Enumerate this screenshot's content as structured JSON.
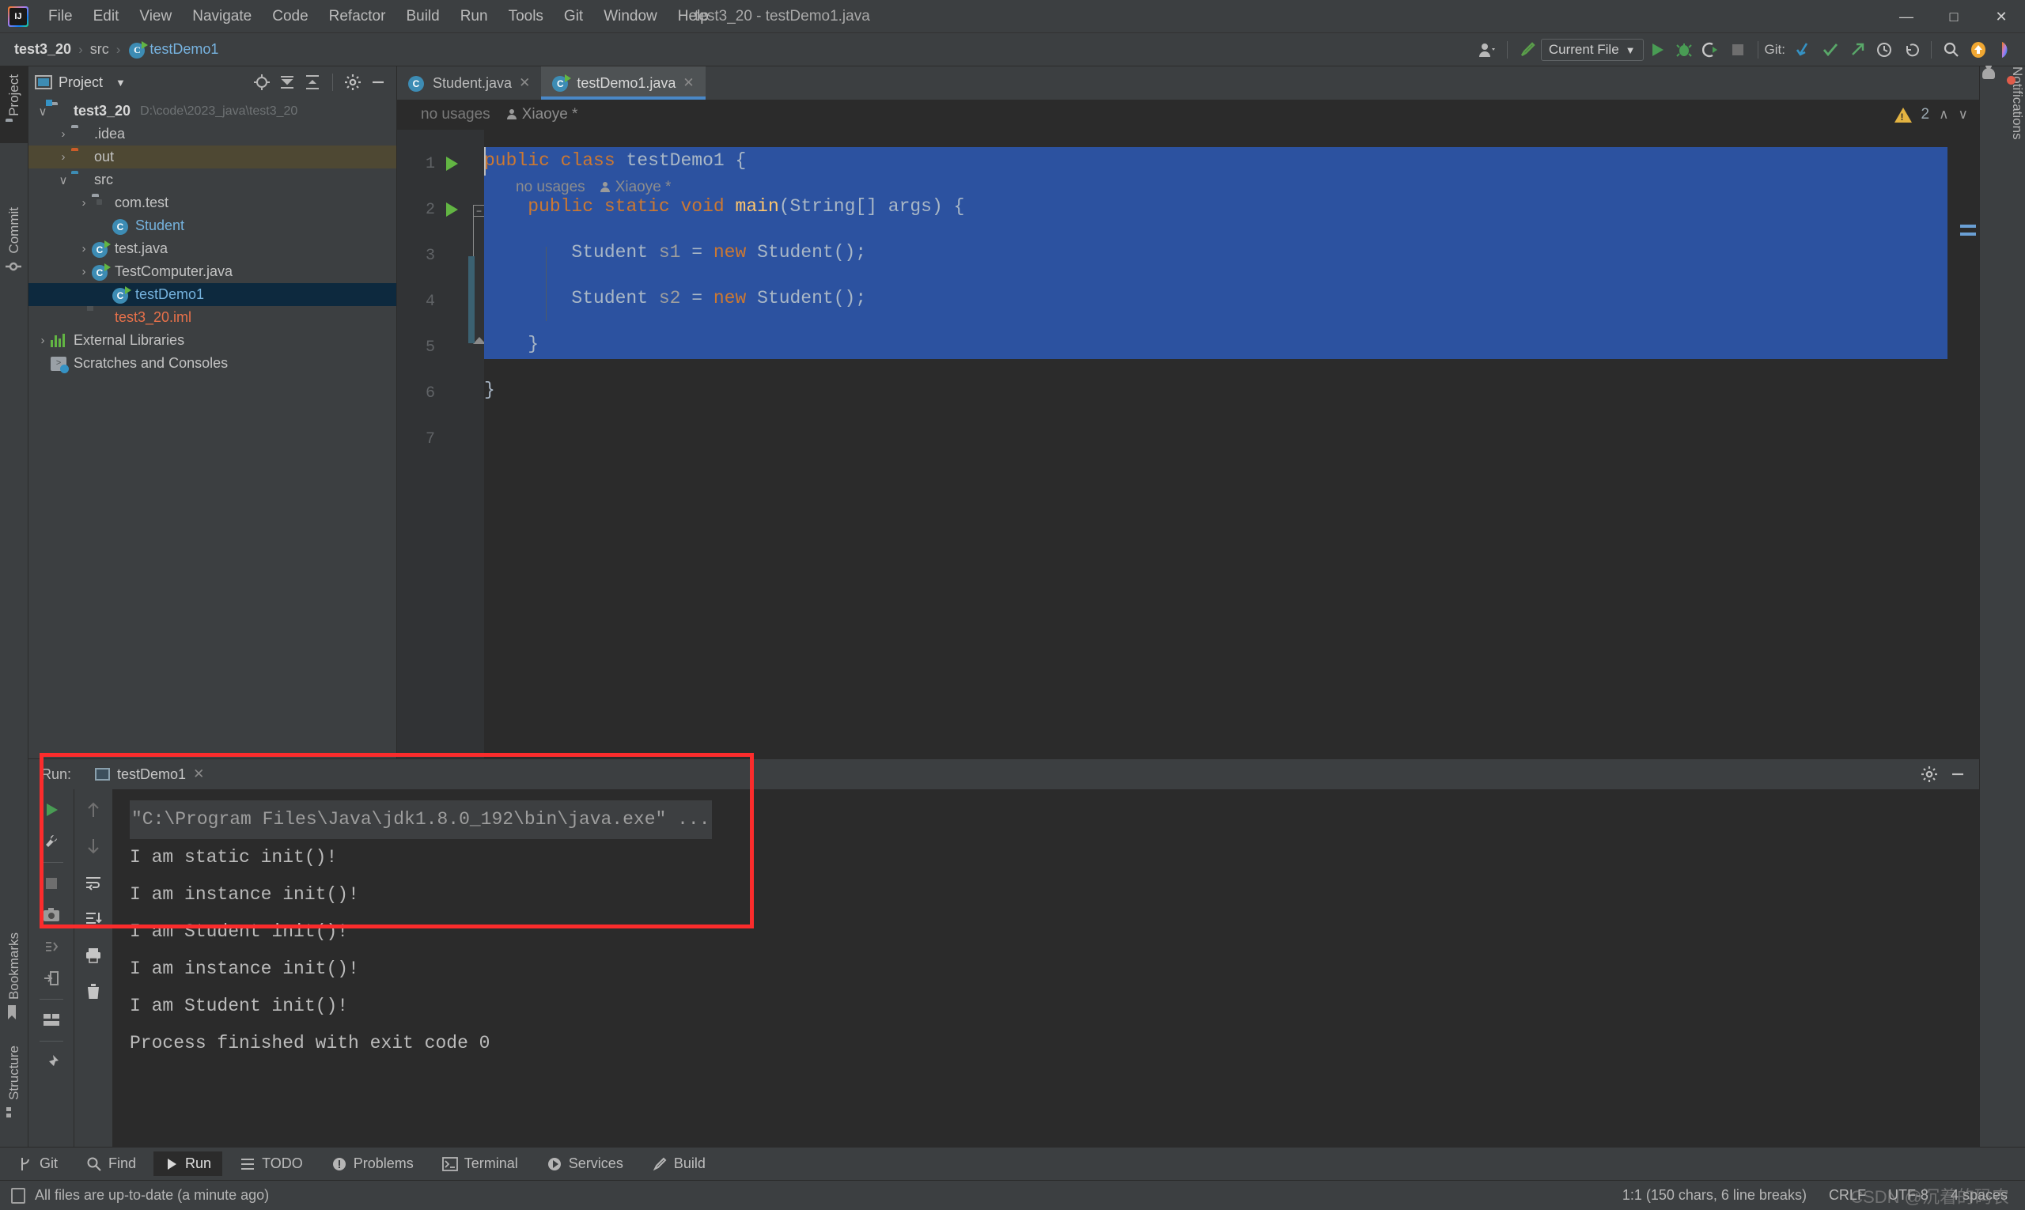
{
  "window": {
    "title": "test3_20 - testDemo1.java",
    "minimize": "—",
    "maximize": "□",
    "close": "✕"
  },
  "menu": {
    "items": [
      "File",
      "Edit",
      "View",
      "Navigate",
      "Code",
      "Refactor",
      "Build",
      "Run",
      "Tools",
      "Git",
      "Window",
      "Help"
    ]
  },
  "navbar": {
    "crumbs": [
      "test3_20",
      "src",
      "testDemo1"
    ],
    "separator": "›",
    "run_config": "Current File",
    "git_label": "Git:"
  },
  "left_strip": {
    "tabs": [
      "Project",
      "Commit"
    ],
    "bottom_tabs": [
      "Bookmarks",
      "Structure"
    ]
  },
  "right_strip": {
    "label": "Notifications"
  },
  "project_panel": {
    "title": "Project",
    "tree": [
      {
        "label": "test3_20",
        "path": "D:\\code\\2023_java\\test3_20",
        "indent": 0,
        "arrow": "∨",
        "icon": "module-folder-icon",
        "style": "bold"
      },
      {
        "label": ".idea",
        "path": "",
        "indent": 1,
        "arrow": "›",
        "icon": "folder-icon",
        "style": "plain"
      },
      {
        "label": "out",
        "path": "",
        "indent": 1,
        "arrow": "›",
        "icon": "out-folder-icon",
        "style": "plain",
        "selected": "out"
      },
      {
        "label": "src",
        "path": "",
        "indent": 1,
        "arrow": "∨",
        "icon": "source-folder-icon",
        "style": "plain"
      },
      {
        "label": "com.test",
        "path": "",
        "indent": 2,
        "arrow": "›",
        "icon": "package-icon",
        "style": "plain"
      },
      {
        "label": "Student",
        "path": "",
        "indent": 3,
        "arrow": "",
        "icon": "class-icon",
        "style": "blue"
      },
      {
        "label": "test.java",
        "path": "",
        "indent": 2,
        "arrow": "›",
        "icon": "runnable-class-icon",
        "style": "plain"
      },
      {
        "label": "TestComputer.java",
        "path": "",
        "indent": 2,
        "arrow": "›",
        "icon": "runnable-class-icon",
        "style": "plain"
      },
      {
        "label": "testDemo1",
        "path": "",
        "indent": 3,
        "arrow": "",
        "icon": "runnable-class-icon",
        "style": "blue",
        "selected": "blue"
      },
      {
        "label": "test3_20.iml",
        "path": "",
        "indent": 2,
        "arrow": "",
        "icon": "iml-file-icon",
        "style": "orange"
      },
      {
        "label": "External Libraries",
        "path": "",
        "indent": 0,
        "arrow": "›",
        "icon": "libraries-icon",
        "style": "plain"
      },
      {
        "label": "Scratches and Consoles",
        "path": "",
        "indent": 0,
        "arrow": "",
        "icon": "scratches-icon",
        "style": "plain"
      }
    ]
  },
  "editor": {
    "tabs": [
      {
        "label": "Student.java",
        "active": false,
        "close": "✕",
        "icon": "class-icon"
      },
      {
        "label": "testDemo1.java",
        "active": true,
        "close": "✕",
        "icon": "runnable-class-icon"
      }
    ],
    "inlay_top": {
      "usages": "no usages",
      "author": "Xiaoye *"
    },
    "inlay_nested": {
      "usages": "no usages",
      "author": "Xiaoye *"
    },
    "warning_count": "2",
    "chevron_up": "∧",
    "chevron_down": "∨",
    "line_numbers": [
      "1",
      "2",
      "3",
      "4",
      "5",
      "6",
      "7"
    ],
    "code_lines": [
      {
        "n": 1,
        "segments": [
          {
            "t": "public",
            "c": "k"
          },
          {
            "t": " ",
            "c": "t"
          },
          {
            "t": "class",
            "c": "k"
          },
          {
            "t": " testDemo1 {",
            "c": "t"
          }
        ]
      },
      {
        "n": 2,
        "segments": [
          {
            "t": "    ",
            "c": "t"
          },
          {
            "t": "public",
            "c": "k"
          },
          {
            "t": " ",
            "c": "t"
          },
          {
            "t": "static",
            "c": "k"
          },
          {
            "t": " ",
            "c": "t"
          },
          {
            "t": "void",
            "c": "k"
          },
          {
            "t": " ",
            "c": "t"
          },
          {
            "t": "main",
            "c": "m"
          },
          {
            "t": "(String[] args) {",
            "c": "t"
          }
        ]
      },
      {
        "n": 3,
        "segments": [
          {
            "t": "        Student ",
            "c": "t"
          },
          {
            "t": "s1",
            "c": "v"
          },
          {
            "t": " = ",
            "c": "t"
          },
          {
            "t": "new",
            "c": "k"
          },
          {
            "t": " Student();",
            "c": "t"
          }
        ]
      },
      {
        "n": 4,
        "segments": [
          {
            "t": "        Student ",
            "c": "t"
          },
          {
            "t": "s2",
            "c": "v"
          },
          {
            "t": " = ",
            "c": "t"
          },
          {
            "t": "new",
            "c": "k"
          },
          {
            "t": " Student();",
            "c": "t"
          }
        ]
      },
      {
        "n": 5,
        "segments": [
          {
            "t": "    }",
            "c": "t"
          }
        ]
      },
      {
        "n": 6,
        "segments": [
          {
            "t": "}",
            "c": "t"
          }
        ]
      },
      {
        "n": 7,
        "segments": []
      }
    ]
  },
  "run_panel": {
    "header_label": "Run:",
    "tab_label": "testDemo1",
    "tab_close": "✕",
    "console_lines": [
      {
        "text": "\"C:\\Program Files\\Java\\jdk1.8.0_192\\bin\\java.exe\" ...",
        "style": "cmd"
      },
      {
        "text": "I am static init()!",
        "style": "out"
      },
      {
        "text": "I am instance init()!",
        "style": "out"
      },
      {
        "text": "I am Student init()!",
        "style": "out"
      },
      {
        "text": "I am instance init()!",
        "style": "out"
      },
      {
        "text": "I am Student init()!",
        "style": "out"
      },
      {
        "text": "",
        "style": "out"
      },
      {
        "text": "Process finished with exit code 0",
        "style": "out"
      }
    ]
  },
  "bottom_bar": {
    "items": [
      {
        "label": "Git",
        "icon": "git-branch-icon",
        "active": false
      },
      {
        "label": "Find",
        "icon": "search-icon",
        "active": false
      },
      {
        "label": "Run",
        "icon": "play-icon",
        "active": true
      },
      {
        "label": "TODO",
        "icon": "list-icon",
        "active": false
      },
      {
        "label": "Problems",
        "icon": "problems-icon",
        "active": false
      },
      {
        "label": "Terminal",
        "icon": "terminal-icon",
        "active": false
      },
      {
        "label": "Services",
        "icon": "services-icon",
        "active": false
      },
      {
        "label": "Build",
        "icon": "build-hammer-icon",
        "active": false
      }
    ]
  },
  "status_bar": {
    "message": "All files are up-to-date (a minute ago)",
    "caret": "1:1 (150 chars, 6 line breaks)",
    "line_sep": "CRLF",
    "encoding": "UTF-8",
    "indent": "4 spaces",
    "watermark": "CSDN @沉着的码农"
  },
  "colors": {
    "accent_blue": "#4a88c7",
    "selection_blue": "#2c52a0",
    "keyword_orange": "#cc7832",
    "method_yellow": "#ffc66d",
    "run_green": "#62b543",
    "red_box": "#fb2c2c",
    "warning_yellow": "#e3b341"
  }
}
